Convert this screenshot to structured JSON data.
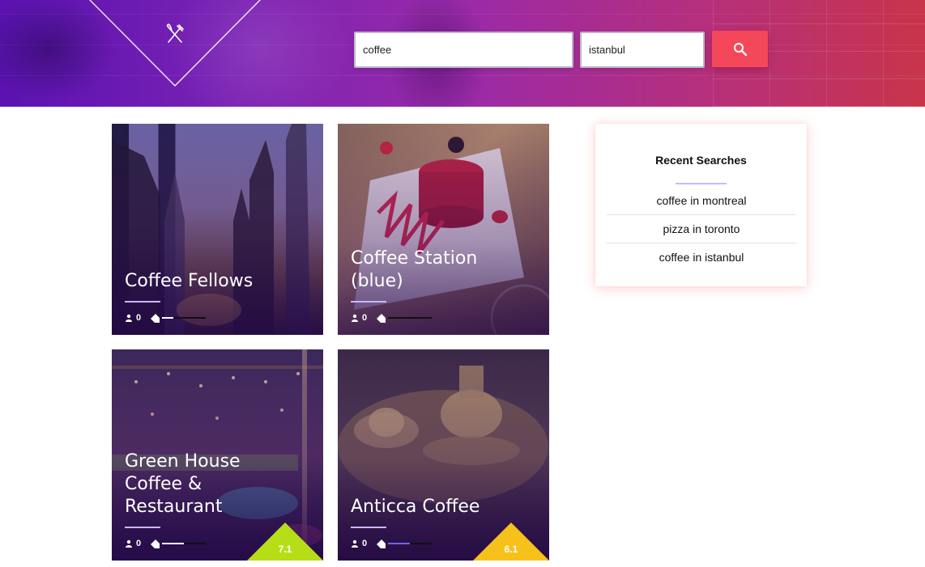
{
  "header": {
    "search_term_value": "coffee",
    "search_location_value": "istanbul",
    "colors": {
      "gradient_start": "#5a12b0",
      "gradient_end": "#c8344a",
      "search_button": "#f4485a"
    }
  },
  "cards": [
    {
      "title": "Coffee Fellows",
      "count": "0",
      "rating": "",
      "price_fill": 0.25
    },
    {
      "title": "Coffee Station (blue)",
      "count": "0",
      "rating": "",
      "price_fill": 0
    },
    {
      "title": "Green House Coffee & Restaurant",
      "count": "0",
      "rating": "7.1",
      "rating_color": "#b6de16",
      "price_fill": 0.5
    },
    {
      "title": "Anticca Coffee",
      "count": "0",
      "rating": "6.1",
      "rating_color": "#f7c11a",
      "price_fill": 0.5
    }
  ],
  "recent_searches": {
    "title": "Recent Searches",
    "items": [
      "coffee in montreal",
      "pizza in toronto",
      "coffee in istanbul"
    ]
  },
  "icons": [
    "fork-knife-icon",
    "search-icon",
    "person-icon",
    "tag-icon"
  ]
}
